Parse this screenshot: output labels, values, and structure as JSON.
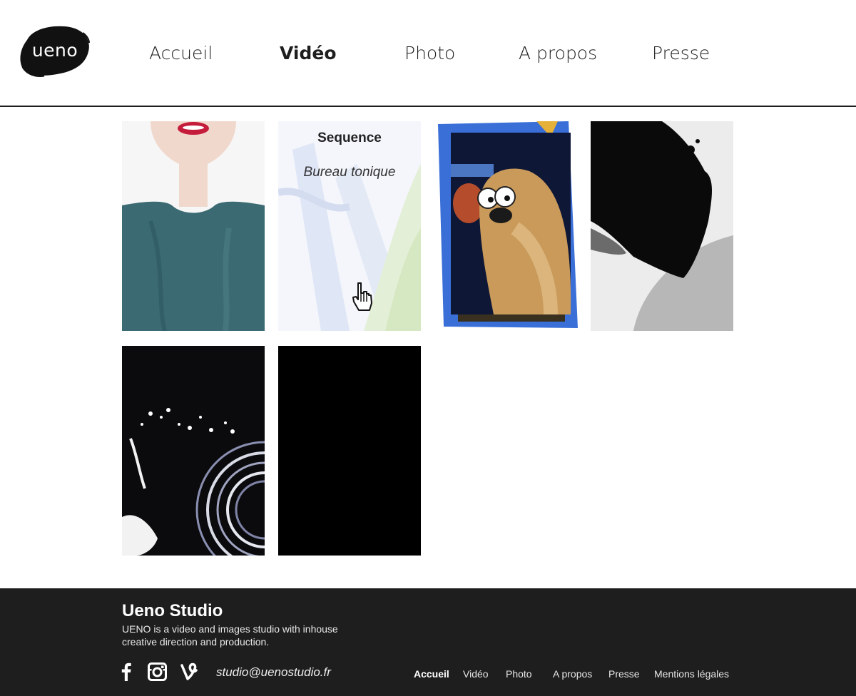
{
  "logo": {
    "text": "ueno"
  },
  "nav": {
    "items": [
      {
        "label": "Accueil"
      },
      {
        "label": "Vidéo",
        "active": true
      },
      {
        "label": "Photo"
      },
      {
        "label": "A propos"
      },
      {
        "label": "Presse"
      }
    ]
  },
  "grid": {
    "hovered_tile": {
      "title": "Sequence",
      "subtitle": "Bureau tonique"
    }
  },
  "footer": {
    "title": "Ueno Studio",
    "description": "UENO is a video and images studio with inhouse creative direction and production.",
    "email": "studio@uenostudio.fr",
    "social": [
      "facebook-icon",
      "instagram-icon",
      "vine-icon"
    ],
    "links": [
      {
        "label": "Accueil",
        "active": true
      },
      {
        "label": "Vidéo"
      },
      {
        "label": "Photo"
      },
      {
        "label": "A propos"
      },
      {
        "label": "Presse"
      },
      {
        "label": "Mentions légales"
      }
    ]
  },
  "colors": {
    "dark": "#1e1e1e",
    "background": "#ffffff"
  }
}
